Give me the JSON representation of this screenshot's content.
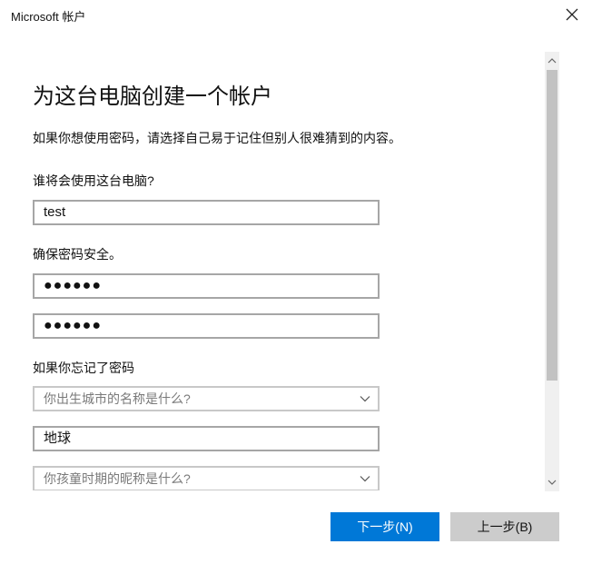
{
  "window": {
    "title": "Microsoft 帐户"
  },
  "page": {
    "heading": "为这台电脑创建一个帐户",
    "description": "如果你想使用密码，请选择自己易于记住但别人很难猜到的内容。"
  },
  "form": {
    "user_label": "谁将会使用这台电脑?",
    "user_value": "test",
    "password_label": "确保密码安全。",
    "password_value": "●●●●●●",
    "password_confirm_value": "●●●●●●",
    "forgot_label": "如果你忘记了密码",
    "question1_placeholder": "你出生城市的名称是什么?",
    "answer1_value": "地球",
    "question2_placeholder": "你孩童时期的昵称是什么?"
  },
  "buttons": {
    "next_label": "下一步(N)",
    "back_label": "上一步(B)"
  },
  "colors": {
    "accent": "#0078d7",
    "secondary_button": "#cccccc",
    "field_border": "#a6a6a6"
  },
  "icons": {
    "close": "close-icon",
    "dropdown": "chevron-down-icon",
    "scroll_up": "scroll-up-arrow-icon",
    "scroll_down": "scroll-down-arrow-icon"
  }
}
